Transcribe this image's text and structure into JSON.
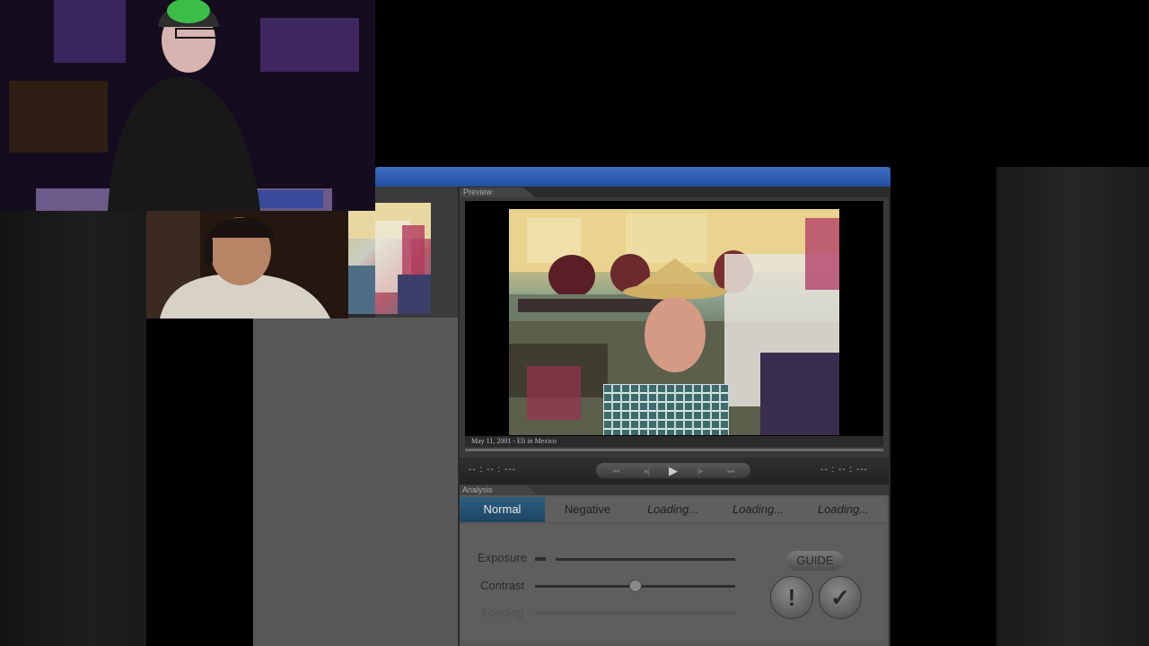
{
  "preview": {
    "tab_label": "Preview",
    "caption": "May 11, 2001 - Eli in Mexico",
    "time_left": "-- : -- : ---",
    "time_right": "-- : -- : ---",
    "controls": {
      "skip_back": "⏮",
      "step_back": "◂|",
      "play": "▶",
      "step_forward": "|▸",
      "skip_forward": "⏭"
    }
  },
  "analysis": {
    "tab_label": "Analysis",
    "modes": [
      {
        "label": "Normal",
        "active": true
      },
      {
        "label": "Negative",
        "active": false
      },
      {
        "label": "Loading...",
        "active": false
      },
      {
        "label": "Loading...",
        "active": false
      },
      {
        "label": "Loading...",
        "active": false
      }
    ],
    "sliders": [
      {
        "label": "Exposure",
        "value": 0.0
      },
      {
        "label": "Contrast",
        "value": 0.5
      },
      {
        "label": "Loading",
        "value": 0.5,
        "disabled": true
      }
    ],
    "guide_label": "GUIDE",
    "warning_symbol": "!",
    "confirm_symbol": "✓"
  },
  "icons": {
    "warning": "exclamation-icon",
    "confirm": "checkmark-icon",
    "play": "play-icon"
  },
  "colors": {
    "title_bar": "#2f5fb3",
    "active_tab": "#245473"
  }
}
